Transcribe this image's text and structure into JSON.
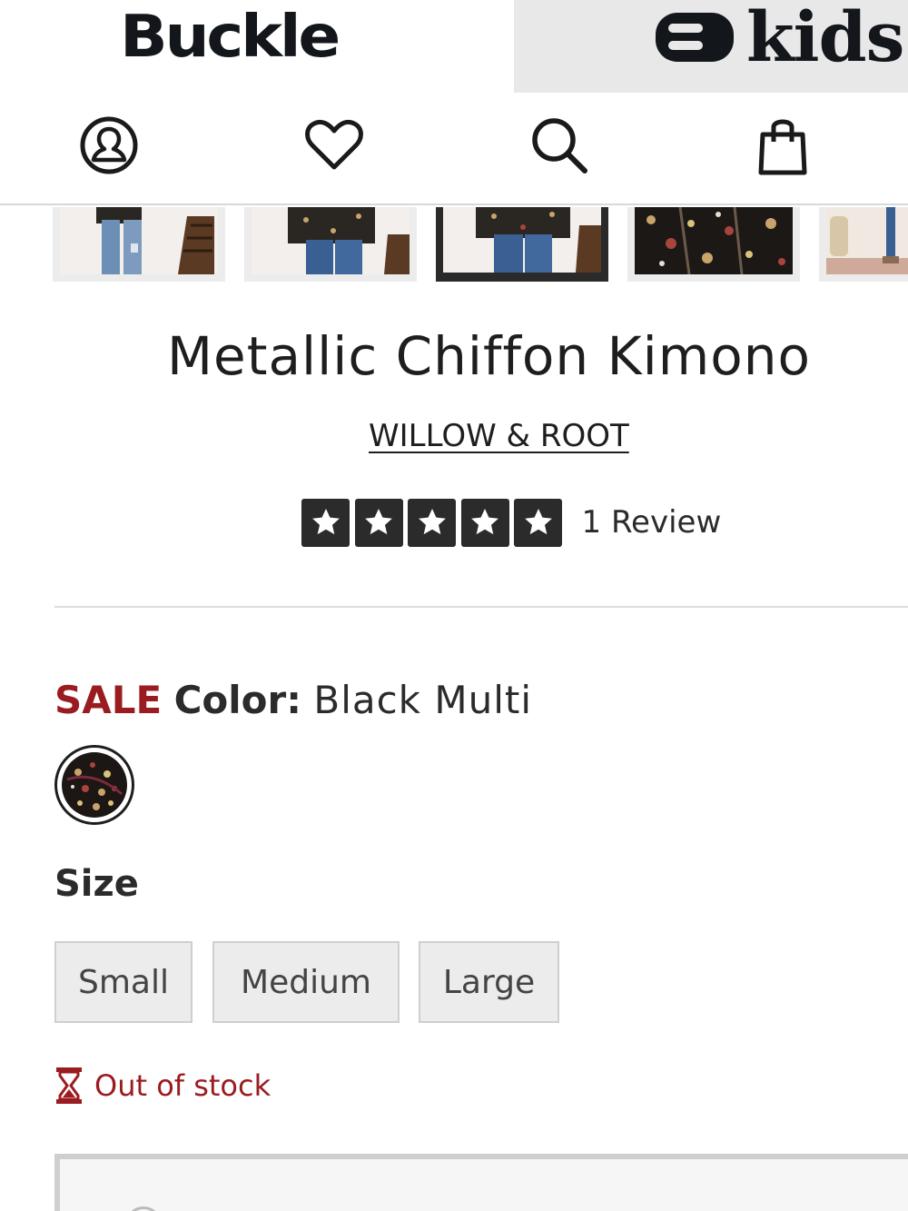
{
  "header": {
    "brand_logo": "Buckle",
    "kids_logo": "kids"
  },
  "nav": {
    "icons": [
      "account-icon",
      "heart-icon",
      "search-icon",
      "shopping-bag-icon"
    ]
  },
  "thumbnails": {
    "count_visible": 5,
    "selected_index": 2
  },
  "product": {
    "title": "Metallic Chiffon Kimono",
    "brand": "WILLOW & ROOT",
    "rating": {
      "stars": 5,
      "max": 5,
      "review_text": "1 Review"
    }
  },
  "color": {
    "sale_label": "SALE",
    "label": "Color:",
    "value": "Black Multi"
  },
  "size": {
    "heading": "Size",
    "options": [
      "Small",
      "Medium",
      "Large"
    ]
  },
  "stock": {
    "status": "Out of stock"
  },
  "colors": {
    "sale_red": "#9b1c20",
    "text_dark": "#2b2b2b",
    "kids_tab_bg": "#e8e8e8"
  }
}
